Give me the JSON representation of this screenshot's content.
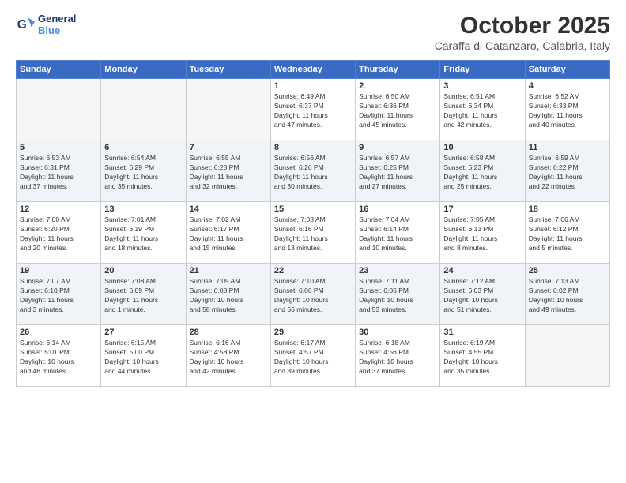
{
  "logo": {
    "line1": "General",
    "line2": "Blue"
  },
  "title": "October 2025",
  "subtitle": "Caraffa di Catanzaro, Calabria, Italy",
  "days_of_week": [
    "Sunday",
    "Monday",
    "Tuesday",
    "Wednesday",
    "Thursday",
    "Friday",
    "Saturday"
  ],
  "weeks": [
    {
      "shaded": false,
      "days": [
        {
          "num": "",
          "info": ""
        },
        {
          "num": "",
          "info": ""
        },
        {
          "num": "",
          "info": ""
        },
        {
          "num": "1",
          "info": "Sunrise: 6:49 AM\nSunset: 6:37 PM\nDaylight: 11 hours\nand 47 minutes."
        },
        {
          "num": "2",
          "info": "Sunrise: 6:50 AM\nSunset: 6:36 PM\nDaylight: 11 hours\nand 45 minutes."
        },
        {
          "num": "3",
          "info": "Sunrise: 6:51 AM\nSunset: 6:34 PM\nDaylight: 11 hours\nand 42 minutes."
        },
        {
          "num": "4",
          "info": "Sunrise: 6:52 AM\nSunset: 6:33 PM\nDaylight: 11 hours\nand 40 minutes."
        }
      ]
    },
    {
      "shaded": true,
      "days": [
        {
          "num": "5",
          "info": "Sunrise: 6:53 AM\nSunset: 6:31 PM\nDaylight: 11 hours\nand 37 minutes."
        },
        {
          "num": "6",
          "info": "Sunrise: 6:54 AM\nSunset: 6:29 PM\nDaylight: 11 hours\nand 35 minutes."
        },
        {
          "num": "7",
          "info": "Sunrise: 6:55 AM\nSunset: 6:28 PM\nDaylight: 11 hours\nand 32 minutes."
        },
        {
          "num": "8",
          "info": "Sunrise: 6:56 AM\nSunset: 6:26 PM\nDaylight: 11 hours\nand 30 minutes."
        },
        {
          "num": "9",
          "info": "Sunrise: 6:57 AM\nSunset: 6:25 PM\nDaylight: 11 hours\nand 27 minutes."
        },
        {
          "num": "10",
          "info": "Sunrise: 6:58 AM\nSunset: 6:23 PM\nDaylight: 11 hours\nand 25 minutes."
        },
        {
          "num": "11",
          "info": "Sunrise: 6:59 AM\nSunset: 6:22 PM\nDaylight: 11 hours\nand 22 minutes."
        }
      ]
    },
    {
      "shaded": false,
      "days": [
        {
          "num": "12",
          "info": "Sunrise: 7:00 AM\nSunset: 6:20 PM\nDaylight: 11 hours\nand 20 minutes."
        },
        {
          "num": "13",
          "info": "Sunrise: 7:01 AM\nSunset: 6:19 PM\nDaylight: 11 hours\nand 18 minutes."
        },
        {
          "num": "14",
          "info": "Sunrise: 7:02 AM\nSunset: 6:17 PM\nDaylight: 11 hours\nand 15 minutes."
        },
        {
          "num": "15",
          "info": "Sunrise: 7:03 AM\nSunset: 6:16 PM\nDaylight: 11 hours\nand 13 minutes."
        },
        {
          "num": "16",
          "info": "Sunrise: 7:04 AM\nSunset: 6:14 PM\nDaylight: 11 hours\nand 10 minutes."
        },
        {
          "num": "17",
          "info": "Sunrise: 7:05 AM\nSunset: 6:13 PM\nDaylight: 11 hours\nand 8 minutes."
        },
        {
          "num": "18",
          "info": "Sunrise: 7:06 AM\nSunset: 6:12 PM\nDaylight: 11 hours\nand 5 minutes."
        }
      ]
    },
    {
      "shaded": true,
      "days": [
        {
          "num": "19",
          "info": "Sunrise: 7:07 AM\nSunset: 6:10 PM\nDaylight: 11 hours\nand 3 minutes."
        },
        {
          "num": "20",
          "info": "Sunrise: 7:08 AM\nSunset: 6:09 PM\nDaylight: 11 hours\nand 1 minute."
        },
        {
          "num": "21",
          "info": "Sunrise: 7:09 AM\nSunset: 6:08 PM\nDaylight: 10 hours\nand 58 minutes."
        },
        {
          "num": "22",
          "info": "Sunrise: 7:10 AM\nSunset: 6:06 PM\nDaylight: 10 hours\nand 56 minutes."
        },
        {
          "num": "23",
          "info": "Sunrise: 7:11 AM\nSunset: 6:05 PM\nDaylight: 10 hours\nand 53 minutes."
        },
        {
          "num": "24",
          "info": "Sunrise: 7:12 AM\nSunset: 6:03 PM\nDaylight: 10 hours\nand 51 minutes."
        },
        {
          "num": "25",
          "info": "Sunrise: 7:13 AM\nSunset: 6:02 PM\nDaylight: 10 hours\nand 49 minutes."
        }
      ]
    },
    {
      "shaded": false,
      "days": [
        {
          "num": "26",
          "info": "Sunrise: 6:14 AM\nSunset: 5:01 PM\nDaylight: 10 hours\nand 46 minutes."
        },
        {
          "num": "27",
          "info": "Sunrise: 6:15 AM\nSunset: 5:00 PM\nDaylight: 10 hours\nand 44 minutes."
        },
        {
          "num": "28",
          "info": "Sunrise: 6:16 AM\nSunset: 4:58 PM\nDaylight: 10 hours\nand 42 minutes."
        },
        {
          "num": "29",
          "info": "Sunrise: 6:17 AM\nSunset: 4:57 PM\nDaylight: 10 hours\nand 39 minutes."
        },
        {
          "num": "30",
          "info": "Sunrise: 6:18 AM\nSunset: 4:56 PM\nDaylight: 10 hours\nand 37 minutes."
        },
        {
          "num": "31",
          "info": "Sunrise: 6:19 AM\nSunset: 4:55 PM\nDaylight: 10 hours\nand 35 minutes."
        },
        {
          "num": "",
          "info": ""
        }
      ]
    }
  ]
}
